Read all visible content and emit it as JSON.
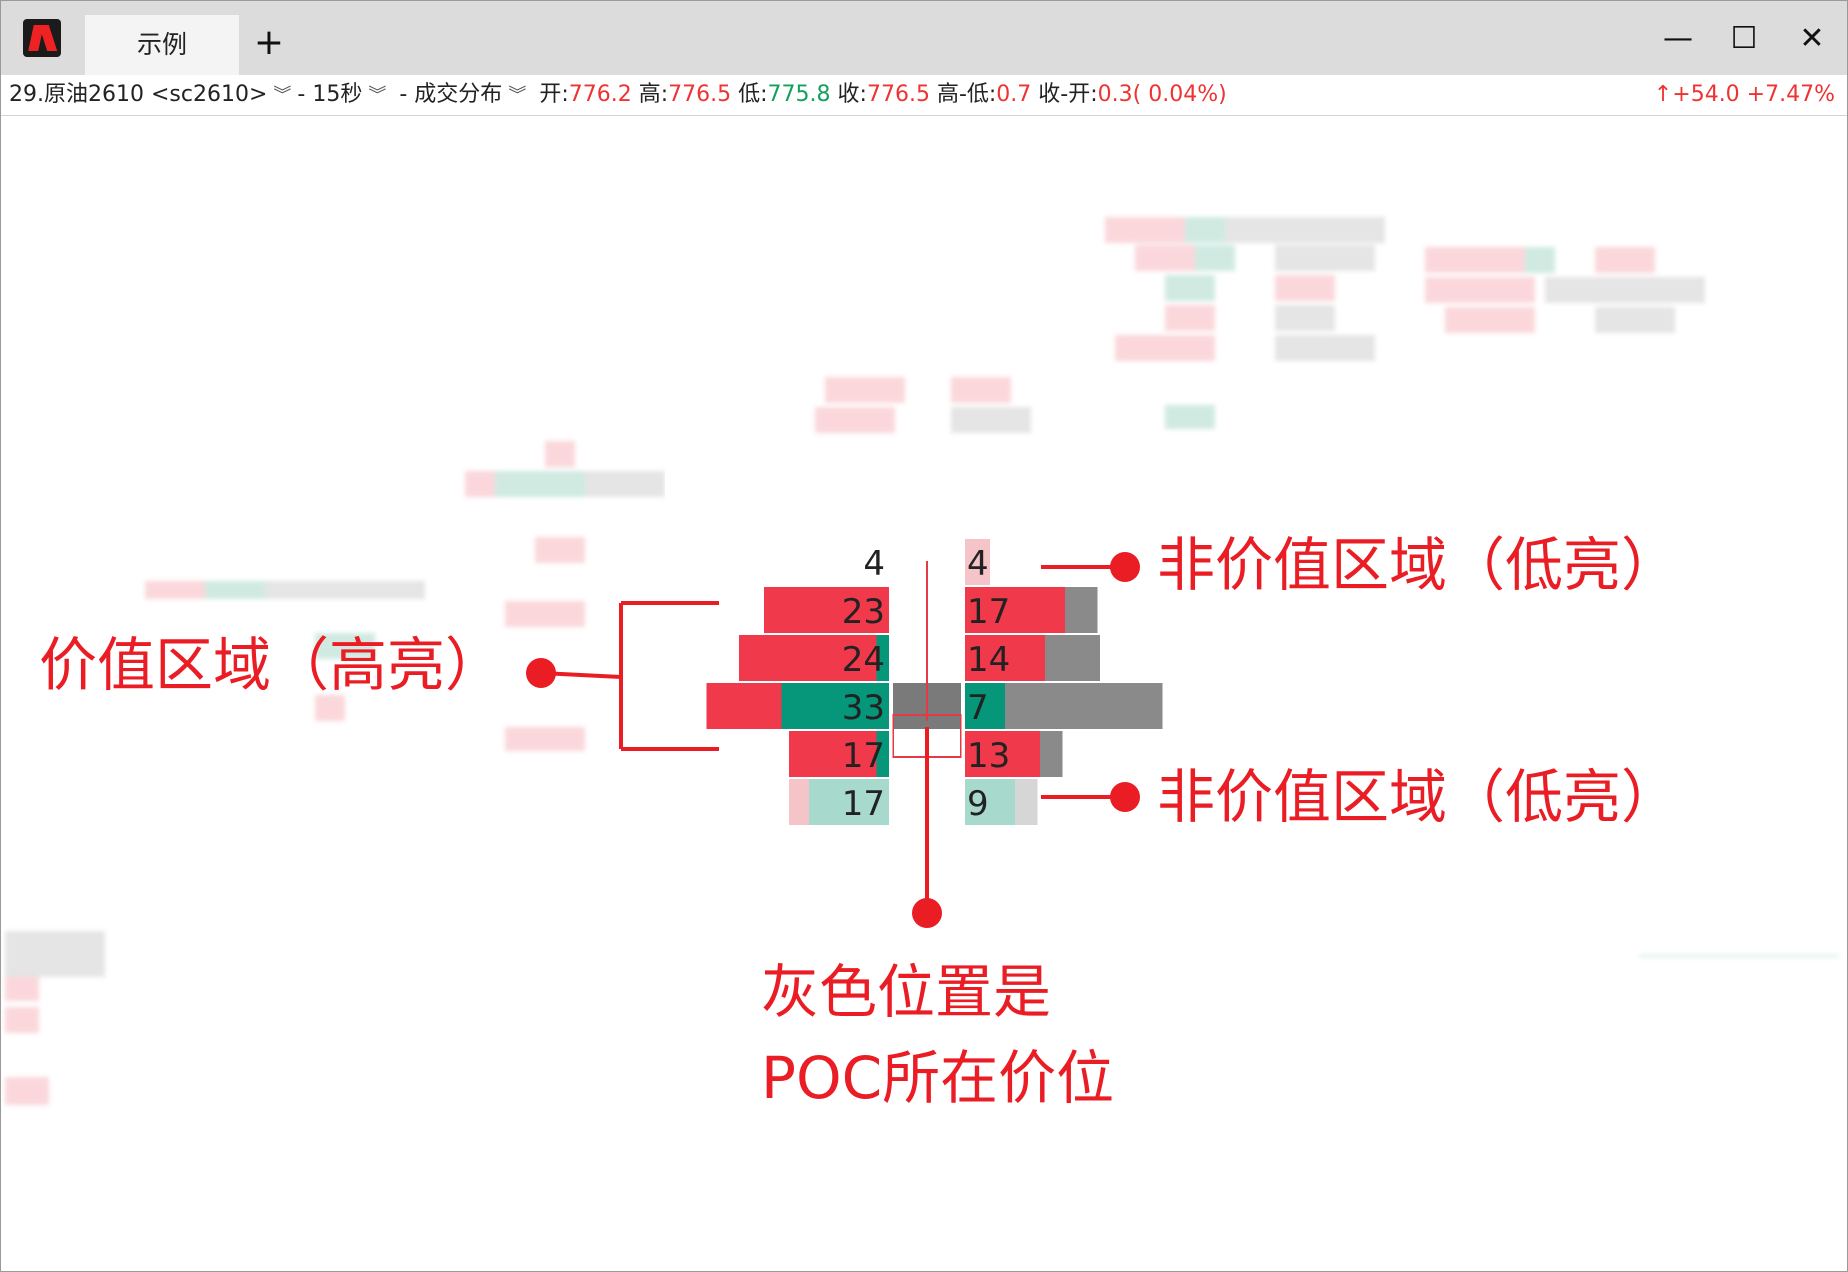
{
  "window": {
    "tab_label": "示例",
    "new_tab_label": "+",
    "minimize_label": "—",
    "maximize_label": "☐",
    "close_label": "✕"
  },
  "infobar": {
    "symbol": "29.原油2610 <sc2610>",
    "sep1": "-",
    "interval": "15秒",
    "sep2": "-",
    "indicator": "成交分布",
    "open_label": "开:",
    "open_value": "776.2",
    "high_label": "高:",
    "high_value": "776.5",
    "low_label": "低:",
    "low_value": "775.8",
    "close_label": "收:",
    "close_value": "776.5",
    "hl_label": "高-低:",
    "hl_value": "0.7",
    "co_label": "收-开:",
    "co_value": "0.3( 0.04%)",
    "change": "↑+54.0 +7.47%"
  },
  "footprint": {
    "poc_color": "#7a7a7a",
    "value_area_sell": "#f0394a",
    "value_area_buy": "#06967a",
    "non_value_sell": "#f4c4c8",
    "non_value_buy": "#a7d9cc",
    "volume_bar": "#8a8a8a",
    "rows": [
      {
        "bid": "4",
        "ask": "4",
        "value_area": false,
        "bid_sell": 0,
        "bid_buy": 0,
        "ask_sell": 1,
        "ask_buy": 0,
        "vol": 0
      },
      {
        "bid": "23",
        "ask": "17",
        "value_area": true,
        "bid_sell": 5,
        "bid_buy": 0,
        "ask_sell": 4,
        "ask_buy": 0,
        "vol": 1.3
      },
      {
        "bid": "24",
        "ask": "14",
        "value_area": true,
        "bid_sell": 5.5,
        "bid_buy": 0.5,
        "ask_sell": 3.2,
        "ask_buy": 0,
        "vol": 2.2
      },
      {
        "bid": "33",
        "ask": "7",
        "value_area": true,
        "bid_sell": 3,
        "bid_buy": 4.3,
        "ask_sell": 0,
        "ask_buy": 1.6,
        "vol": 6.3,
        "poc": true
      },
      {
        "bid": "17",
        "ask": "13",
        "value_area": true,
        "bid_sell": 3.5,
        "bid_buy": 0.5,
        "ask_sell": 3,
        "ask_buy": 0,
        "vol": 0.9
      },
      {
        "bid": "17",
        "ask": "9",
        "value_area": false,
        "bid_sell": 0.8,
        "bid_buy": 3.2,
        "ask_sell": 0,
        "ask_buy": 2,
        "vol": 0.9
      }
    ]
  },
  "annotations": {
    "value_area": "价值区域（高亮）",
    "non_value_area_top": "非价值区域（低亮）",
    "non_value_area_bottom": "非价值区域（低亮）",
    "poc_line1": "灰色位置是",
    "poc_line2": "POC所在价位"
  }
}
